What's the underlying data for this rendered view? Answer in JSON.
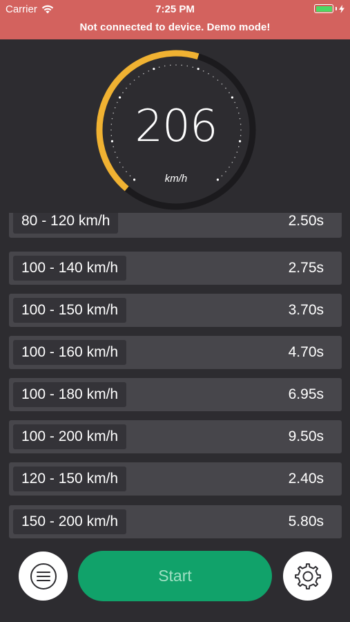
{
  "status_bar": {
    "carrier": "Carrier",
    "time": "7:25 PM",
    "battery_level": 1.0
  },
  "banner": {
    "text": "Not connected to device. Demo mode!",
    "background": "#d3625e"
  },
  "gauge": {
    "speed": "206",
    "unit": "km/h",
    "fill_fraction": 0.56,
    "accent": "#f0b232"
  },
  "intervals": [
    {
      "range": "80 - 120 km/h",
      "time": "2.50s"
    },
    {
      "range": "100 - 140 km/h",
      "time": "2.75s"
    },
    {
      "range": "100 - 150 km/h",
      "time": "3.70s"
    },
    {
      "range": "100 - 160 km/h",
      "time": "4.70s"
    },
    {
      "range": "100 - 180 km/h",
      "time": "6.95s"
    },
    {
      "range": "100 - 200 km/h",
      "time": "9.50s"
    },
    {
      "range": "120 - 150 km/h",
      "time": "2.40s"
    },
    {
      "range": "150 - 200 km/h",
      "time": "5.80s"
    }
  ],
  "actions": {
    "start_label": "Start",
    "start_color": "#11a26a",
    "menu_icon": "list-icon",
    "settings_icon": "gear-icon"
  }
}
